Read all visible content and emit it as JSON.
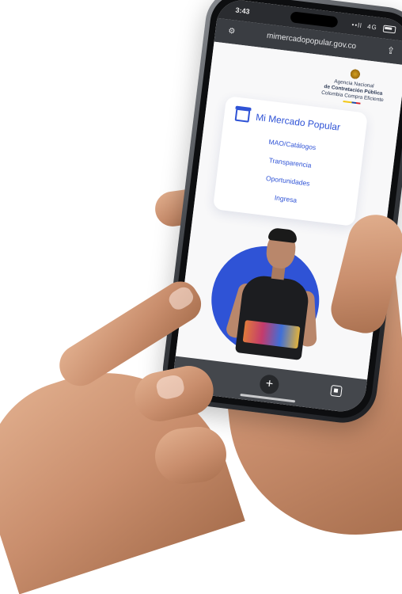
{
  "status_bar": {
    "time": "3:43",
    "signal": "••ll",
    "network": "4G"
  },
  "url_bar": {
    "url": "mimercadopopular.gov.co"
  },
  "header": {
    "agency_lines": [
      "Agencia Nacional",
      "de Contratación Pública",
      "Colombia Compra Eficiente"
    ]
  },
  "menu": {
    "title": "Mi Mercado Popular",
    "items": [
      "MAO/Catálogos",
      "Transparencia",
      "Oportunidades",
      "Ingresa"
    ]
  },
  "colors": {
    "brand_blue": "#2f53d6",
    "phone_frame": "#3c3f44"
  },
  "icons": {
    "toolbar": [
      "back-icon",
      "add-tab-icon",
      "tabs-icon"
    ]
  }
}
